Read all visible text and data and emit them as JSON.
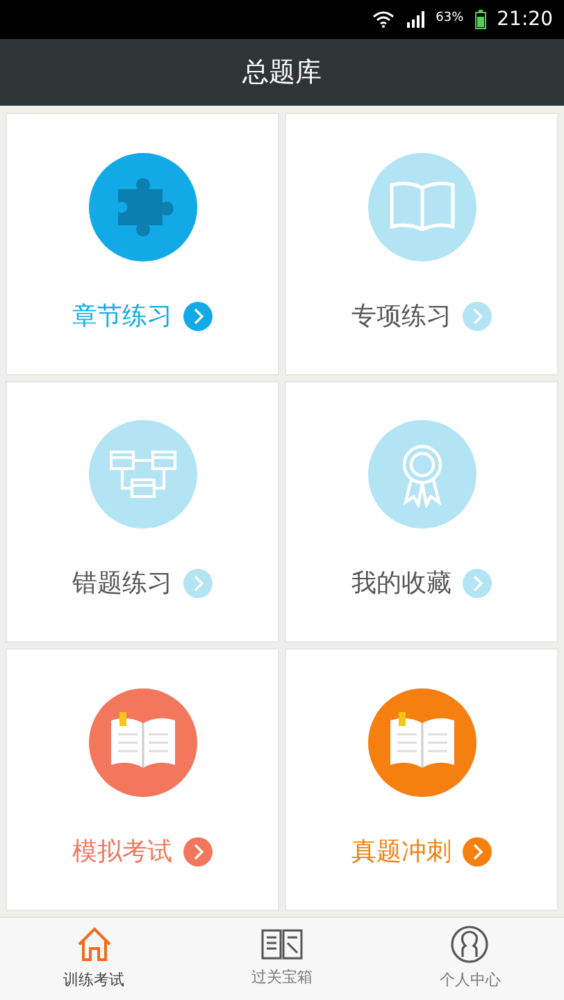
{
  "status_bar": {
    "battery": "63%",
    "time": "21:20"
  },
  "header": {
    "title": "总题库"
  },
  "tiles": [
    {
      "label": "章节练习",
      "kind": "puzzle",
      "color": "#12aae6",
      "highlighted": true
    },
    {
      "label": "专项练习",
      "kind": "book",
      "color": "#b3e4f4",
      "highlighted": false
    },
    {
      "label": "错题练习",
      "kind": "chart",
      "color": "#b3e4f4",
      "highlighted": false
    },
    {
      "label": "我的收藏",
      "kind": "ribbon",
      "color": "#b3e4f4",
      "highlighted": false
    },
    {
      "label": "模拟考试",
      "kind": "exam_book",
      "color": "#f2775c",
      "highlighted": true
    },
    {
      "label": "真题冲刺",
      "kind": "exam_book",
      "color": "#f57f0f",
      "highlighted": true
    }
  ],
  "nav": [
    {
      "label": "训练考试",
      "kind": "home",
      "selected": true
    },
    {
      "label": "过关宝箱",
      "kind": "book",
      "selected": false
    },
    {
      "label": "个人中心",
      "kind": "person",
      "selected": false
    }
  ]
}
